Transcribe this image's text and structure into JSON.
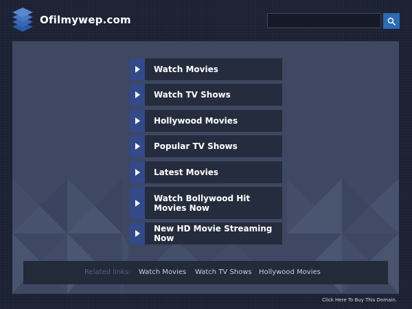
{
  "header": {
    "site_title": "Ofilmywep.com",
    "logo_icon": "stacked-layers-icon",
    "search": {
      "placeholder": "",
      "value": "",
      "button_icon": "search-icon"
    }
  },
  "menu": {
    "items": [
      {
        "label": "Watch Movies",
        "icon": "play-arrow-icon"
      },
      {
        "label": "Watch TV Shows",
        "icon": "play-arrow-icon"
      },
      {
        "label": "Hollywood Movies",
        "icon": "play-arrow-icon"
      },
      {
        "label": "Popular TV Shows",
        "icon": "play-arrow-icon"
      },
      {
        "label": "Latest Movies",
        "icon": "play-arrow-icon"
      },
      {
        "label": "Watch Bollywood Hit Movies Now",
        "icon": "play-arrow-icon"
      },
      {
        "label": "New HD Movie Streaming Now",
        "icon": "play-arrow-icon"
      }
    ]
  },
  "related": {
    "label": "Related links:",
    "links": [
      "Watch Movies",
      "Watch TV Shows",
      "Hollywood Movies"
    ]
  },
  "footer": {
    "buy_link": "Click Here To Buy This Domain."
  },
  "colors": {
    "background": "#1b2132",
    "panel": "#3e4862",
    "menu_item": "#252c3d",
    "menu_arrow": "#33498a",
    "search_button": "#2d6ab3"
  }
}
